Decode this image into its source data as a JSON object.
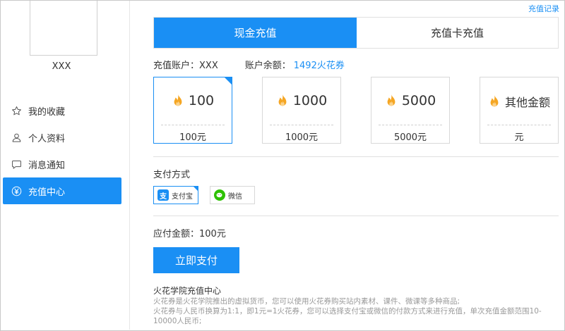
{
  "sidebar": {
    "username": "XXX",
    "items": [
      {
        "label": "我的收藏",
        "icon": "star-icon"
      },
      {
        "label": "个人资料",
        "icon": "user-icon"
      },
      {
        "label": "消息通知",
        "icon": "message-icon"
      },
      {
        "label": "充值中心",
        "icon": "yen-icon",
        "active": true
      }
    ]
  },
  "header": {
    "record_link": "充值记录"
  },
  "tabs": [
    {
      "label": "现金充值",
      "active": true
    },
    {
      "label": "充值卡充值",
      "active": false
    }
  ],
  "account": {
    "account_label": "充值账户：",
    "account_value": "XXX",
    "balance_label": "账户余额：",
    "balance_value": "1492火花券"
  },
  "amounts": [
    {
      "value": "100",
      "price": "100元",
      "selected": true
    },
    {
      "value": "1000",
      "price": "1000元",
      "selected": false
    },
    {
      "value": "5000",
      "price": "5000元",
      "selected": false
    },
    {
      "value": "其他金额",
      "price": "元",
      "selected": false
    }
  ],
  "payment": {
    "title": "支付方式",
    "options": [
      {
        "label": "支付宝",
        "icon": "alipay-icon",
        "color": "#1a8ff4",
        "selected": true
      },
      {
        "label": "微信",
        "icon": "wechat-icon",
        "color": "#2dc100",
        "selected": false
      }
    ]
  },
  "due": {
    "label": "应付金额：",
    "value": "100元"
  },
  "pay_button": "立即支付",
  "info": {
    "title": "火花学院充值中心",
    "lines": [
      "火花券是火花学院推出的虚拟货币，您可以使用火花券购买站内素材、课件、微课等多种商品;",
      "火花券与人民币换算为1:1，即1元=1火花券，您可以选择支付宝或微信的付款方式来进行充值，单次充值金额范围10-10000人民币;"
    ]
  },
  "colors": {
    "accent": "#1a8ff4",
    "flame": "#f5a623",
    "wechat": "#2dc100"
  }
}
